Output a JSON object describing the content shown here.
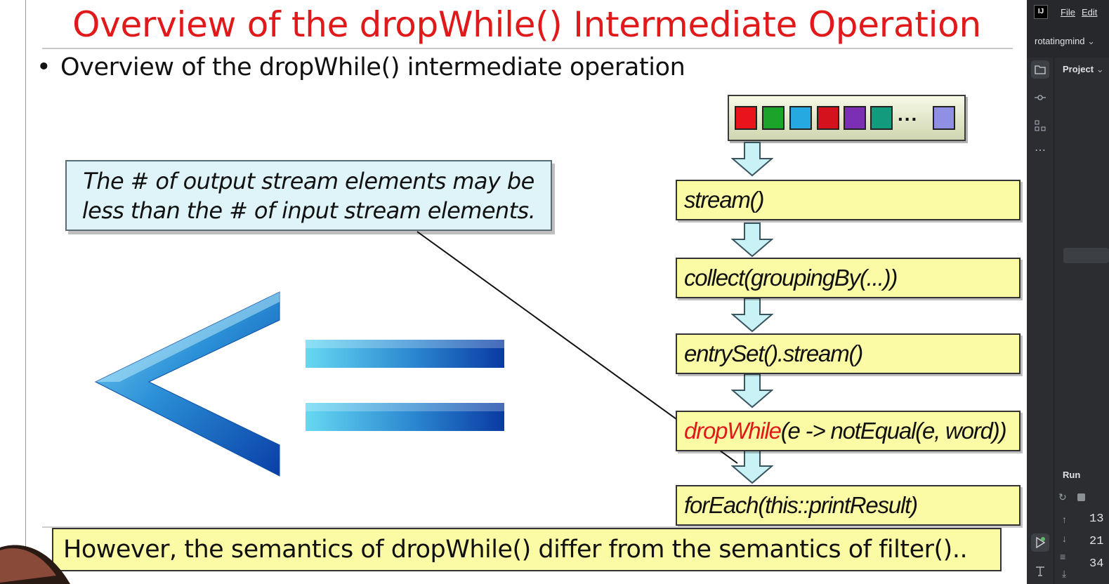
{
  "slide": {
    "title": "Overview of the dropWhile() Intermediate Operation",
    "bullet": "Overview of the dropWhile() intermediate operation",
    "bullet_marker": "•",
    "callout_lines": [
      "The # of output stream elements may be",
      "less than the # of input stream elements."
    ],
    "input_stream": {
      "colors": [
        "#e8131b",
        "#1ca32a",
        "#25a9e0",
        "#d3121e",
        "#7b2fb4",
        "#129b7d",
        "#8f8fe3"
      ],
      "ellipsis": "..."
    },
    "pipeline": [
      {
        "text": "stream()"
      },
      {
        "text": "collect(groupingBy(...))"
      },
      {
        "text": "entrySet().stream()"
      },
      {
        "highlight": "dropWhile",
        "text": "(e -> notEqual(e, word))"
      },
      {
        "text": "forEach(this::printResult)"
      }
    ],
    "bottom_note": "However, the semantics of dropWhile() differ from the semantics of filter()..",
    "accent_color": "#e0191b",
    "box_color": "#fbfba6",
    "symbol": "less-than-or-equal-icon"
  },
  "ide": {
    "logo": "IJ",
    "menu": [
      "File",
      "Edit"
    ],
    "project_name": "rotatingmind",
    "project_label": "Project",
    "run_label": "Run",
    "run_values": [
      "13",
      "21",
      "34"
    ],
    "icons": [
      "folder-icon",
      "commit-icon",
      "structure-icon",
      "more-icon",
      "run-icon",
      "build-icon"
    ]
  }
}
